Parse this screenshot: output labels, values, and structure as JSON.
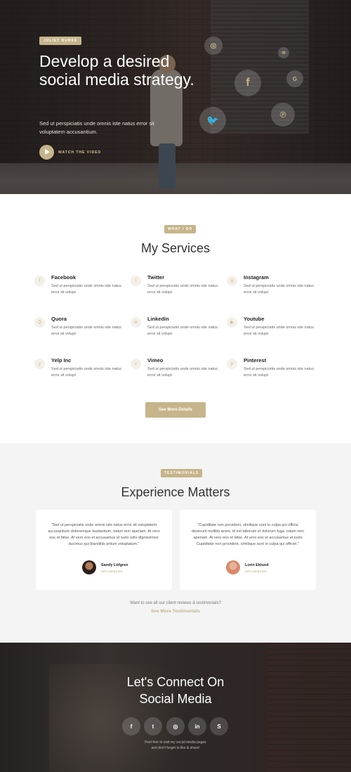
{
  "hero": {
    "badge": "JULIET BURKE",
    "title": "Develop a desired social media strategy.",
    "description": "Sed ut perspiciatis unde omnis iste natus error sit voluptatem accusantium.",
    "watch_label": "WATCH THE VIDEO",
    "bubbles": [
      {
        "icon": "instagram-icon",
        "glyph": "◎"
      },
      {
        "icon": "email-icon",
        "glyph": "✉"
      },
      {
        "icon": "facebook-icon",
        "glyph": "f"
      },
      {
        "icon": "google-icon",
        "glyph": "G"
      },
      {
        "icon": "pinterest-icon",
        "glyph": "℗"
      },
      {
        "icon": "twitter-icon",
        "glyph": "🐦"
      }
    ]
  },
  "services": {
    "badge": "WHAT I DO",
    "title": "My Services",
    "items": [
      {
        "name": "Facebook",
        "text": "Sed ut perspiciatis unde omnis iste natus error sit volupt.",
        "glyph": "f",
        "icon": "facebook-icon"
      },
      {
        "name": "Twitter",
        "text": "Sed ut perspiciatis unde omnis iste natus error sit volupt.",
        "glyph": "t",
        "icon": "twitter-icon"
      },
      {
        "name": "Instagram",
        "text": "Sed ut perspiciatis unde omnis iste natus error sit volupt.",
        "glyph": "◎",
        "icon": "instagram-icon"
      },
      {
        "name": "Quora",
        "text": "Sed ut perspiciatis unde omnis iste natus error sit volupt.",
        "glyph": "Q",
        "icon": "quora-icon"
      },
      {
        "name": "Linkedin",
        "text": "Sed ut perspiciatis unde omnis iste natus error sit volupt.",
        "glyph": "in",
        "icon": "linkedin-icon"
      },
      {
        "name": "Youtube",
        "text": "Sed ut perspiciatis unde omnis iste natus error sit volupt.",
        "glyph": "▶",
        "icon": "youtube-icon"
      },
      {
        "name": "Yelp Inc",
        "text": "Sed ut perspiciatis unde omnis iste natus error sit volupt.",
        "glyph": "y",
        "icon": "yelp-icon"
      },
      {
        "name": "Vimeo",
        "text": "Sed ut perspiciatis unde omnis iste natus error sit volupt.",
        "glyph": "v",
        "icon": "vimeo-icon"
      },
      {
        "name": "Pinterest",
        "text": "Sed ut perspiciatis unde omnis iste natus error sit volupt.",
        "glyph": "p",
        "icon": "pinterest-icon"
      }
    ],
    "button_label": "See More Details"
  },
  "testimonials": {
    "badge": "TESTIMONIALS",
    "title": "Experience Matters",
    "cards": [
      {
        "quote": "\"Sed ut perspiciatis unde omnis iste natus error sit voluptatem accusantium doloremque laudantium, totam rem aperiam. At vero eos et bitse. At vero eos et accusamus et iusto odio dignissimos ducimus qui blanditiis prtium voluptatum.\"",
        "name": "Sandy Löfgren",
        "role": "INFLUENCER"
      },
      {
        "quote": "\"Cupiditate non provident, similique sunt in culpa qui officia deserunt mollitia animi, id est laborum et dolorum fuga. totam rem aperiam. At vero eos et bitse. At vero eos et accusamus et iusto Cupiditate non provident, similique sunt in culpa qui officiel.\"",
        "name": "Lorin Eklund",
        "role": "INFLUENCER"
      }
    ],
    "question": "Want to see all our client reviews & testimonials?",
    "link_label": "See More Testimonials"
  },
  "connect": {
    "title_line1": "Let's Connect On",
    "title_line2": "Social Media",
    "icons": [
      {
        "icon": "facebook-icon",
        "glyph": "f"
      },
      {
        "icon": "twitter-icon",
        "glyph": "t"
      },
      {
        "icon": "instagram-icon",
        "glyph": "◎"
      },
      {
        "icon": "linkedin-icon",
        "glyph": "in"
      },
      {
        "icon": "skype-icon",
        "glyph": "S"
      }
    ],
    "foot_line1": "Feel free to visit my social media pages",
    "foot_line2": "and don't forget to like & share!"
  },
  "colors": {
    "accent": "#c6b48a"
  }
}
